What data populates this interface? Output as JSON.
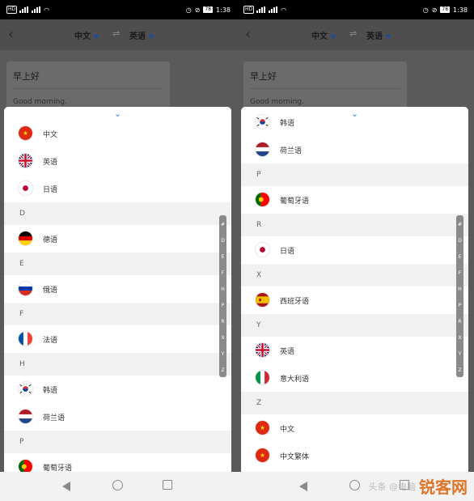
{
  "status_bar": {
    "left_badges": [
      "HD",
      "4G",
      "4G"
    ],
    "battery": "78",
    "time": "1:38"
  },
  "header": {
    "from_lang": "中文",
    "to_lang": "英语"
  },
  "card": {
    "source": "早上好",
    "translation": "Good morning."
  },
  "index_letters": [
    "#",
    "D",
    "E",
    "F",
    "H",
    "P",
    "R",
    "X",
    "Y",
    "Z"
  ],
  "left_list": [
    {
      "kind": "row",
      "flag": "china",
      "label": "中文"
    },
    {
      "kind": "row",
      "flag": "uk",
      "label": "英语"
    },
    {
      "kind": "row",
      "flag": "japan",
      "label": "日语"
    },
    {
      "kind": "header",
      "label": "D"
    },
    {
      "kind": "row",
      "flag": "germany",
      "label": "德语"
    },
    {
      "kind": "header",
      "label": "E"
    },
    {
      "kind": "row",
      "flag": "russia",
      "label": "俄语"
    },
    {
      "kind": "header",
      "label": "F"
    },
    {
      "kind": "row",
      "flag": "france",
      "label": "法语"
    },
    {
      "kind": "header",
      "label": "H"
    },
    {
      "kind": "row",
      "flag": "korea",
      "label": "韩语"
    },
    {
      "kind": "row",
      "flag": "netherlands",
      "label": "荷兰语"
    },
    {
      "kind": "header",
      "label": "P"
    },
    {
      "kind": "row",
      "flag": "portugal",
      "label": "葡萄牙语"
    }
  ],
  "right_list": [
    {
      "kind": "row",
      "flag": "korea",
      "label": "韩语"
    },
    {
      "kind": "row",
      "flag": "netherlands",
      "label": "荷兰语"
    },
    {
      "kind": "header",
      "label": "P"
    },
    {
      "kind": "row",
      "flag": "portugal",
      "label": "葡萄牙语"
    },
    {
      "kind": "header",
      "label": "R"
    },
    {
      "kind": "row",
      "flag": "japan",
      "label": "日语"
    },
    {
      "kind": "header",
      "label": "X"
    },
    {
      "kind": "row",
      "flag": "spain",
      "label": "西班牙语"
    },
    {
      "kind": "header",
      "label": "Y"
    },
    {
      "kind": "row",
      "flag": "uk",
      "label": "英语"
    },
    {
      "kind": "row",
      "flag": "italy",
      "label": "意大利语"
    },
    {
      "kind": "header",
      "label": "Z"
    },
    {
      "kind": "row",
      "flag": "china",
      "label": "中文"
    },
    {
      "kind": "row",
      "flag": "china",
      "label": "中文繁体"
    }
  ],
  "watermark": {
    "brand": "锐客网",
    "faded": "头条 @电脑"
  },
  "colors": {
    "accent_blue": "#1b4d9b",
    "index_bar": "#8a8a8a",
    "watermark": "#e0752a"
  }
}
